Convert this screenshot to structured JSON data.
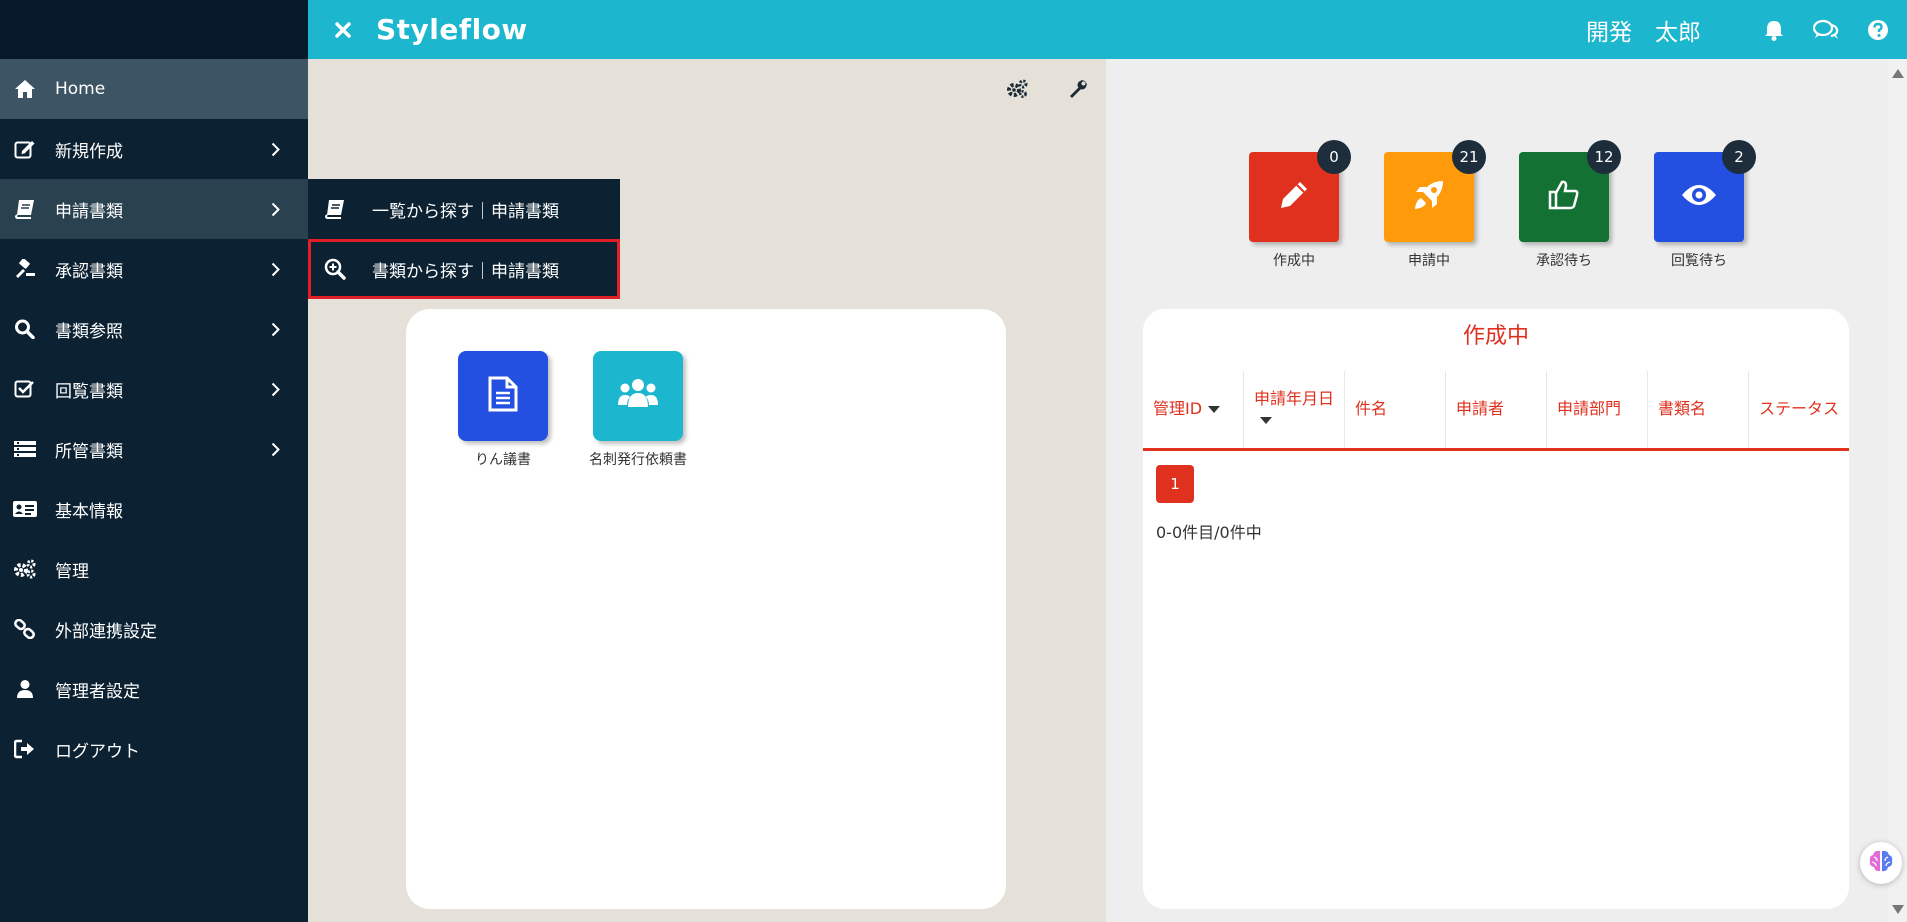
{
  "header": {
    "brand": "Styleflow",
    "user_name": "開発　太郎"
  },
  "sidebar": {
    "items": [
      {
        "label": "Home",
        "icon": "home-icon"
      },
      {
        "label": "新規作成",
        "icon": "edit-icon"
      },
      {
        "label": "申請書類",
        "icon": "book-icon"
      },
      {
        "label": "承認書類",
        "icon": "gavel-icon"
      },
      {
        "label": "書類参照",
        "icon": "search-icon"
      },
      {
        "label": "回覧書類",
        "icon": "check-square-icon"
      },
      {
        "label": "所管書類",
        "icon": "list-icon"
      },
      {
        "label": "基本情報",
        "icon": "id-card-icon"
      },
      {
        "label": "管理",
        "icon": "gears-icon"
      },
      {
        "label": "外部連携設定",
        "icon": "link-icon"
      },
      {
        "label": "管理者設定",
        "icon": "user-icon"
      },
      {
        "label": "ログアウト",
        "icon": "logout-icon"
      }
    ]
  },
  "submenu": {
    "items": [
      {
        "label": "一覧から探す｜申請書類",
        "icon": "book-icon"
      },
      {
        "label": "書類から探す｜申請書類",
        "icon": "search-plus-icon"
      }
    ]
  },
  "documents": {
    "tiles": [
      {
        "label": "りん議書",
        "color": "#2350e0",
        "icon": "document-icon"
      },
      {
        "label": "名刺発行依頼書",
        "color": "#1db6cf",
        "icon": "users-icon"
      }
    ]
  },
  "stats": [
    {
      "label": "作成中",
      "count": "0",
      "color": "#e0301e",
      "icon": "pencil-icon"
    },
    {
      "label": "申請中",
      "count": "21",
      "color": "#ff9b0a",
      "icon": "rocket-icon"
    },
    {
      "label": "承認待ち",
      "count": "12",
      "color": "#137233",
      "icon": "thumbs-up-icon"
    },
    {
      "label": "回覧待ち",
      "count": "2",
      "color": "#2350e0",
      "icon": "eye-icon"
    }
  ],
  "list": {
    "title": "作成中",
    "columns": [
      "管理ID",
      "申請年月日",
      "件名",
      "申請者",
      "申請部門",
      "書類名",
      "ステータス"
    ],
    "page": "1",
    "count_text": "0-0件目/0件中"
  }
}
